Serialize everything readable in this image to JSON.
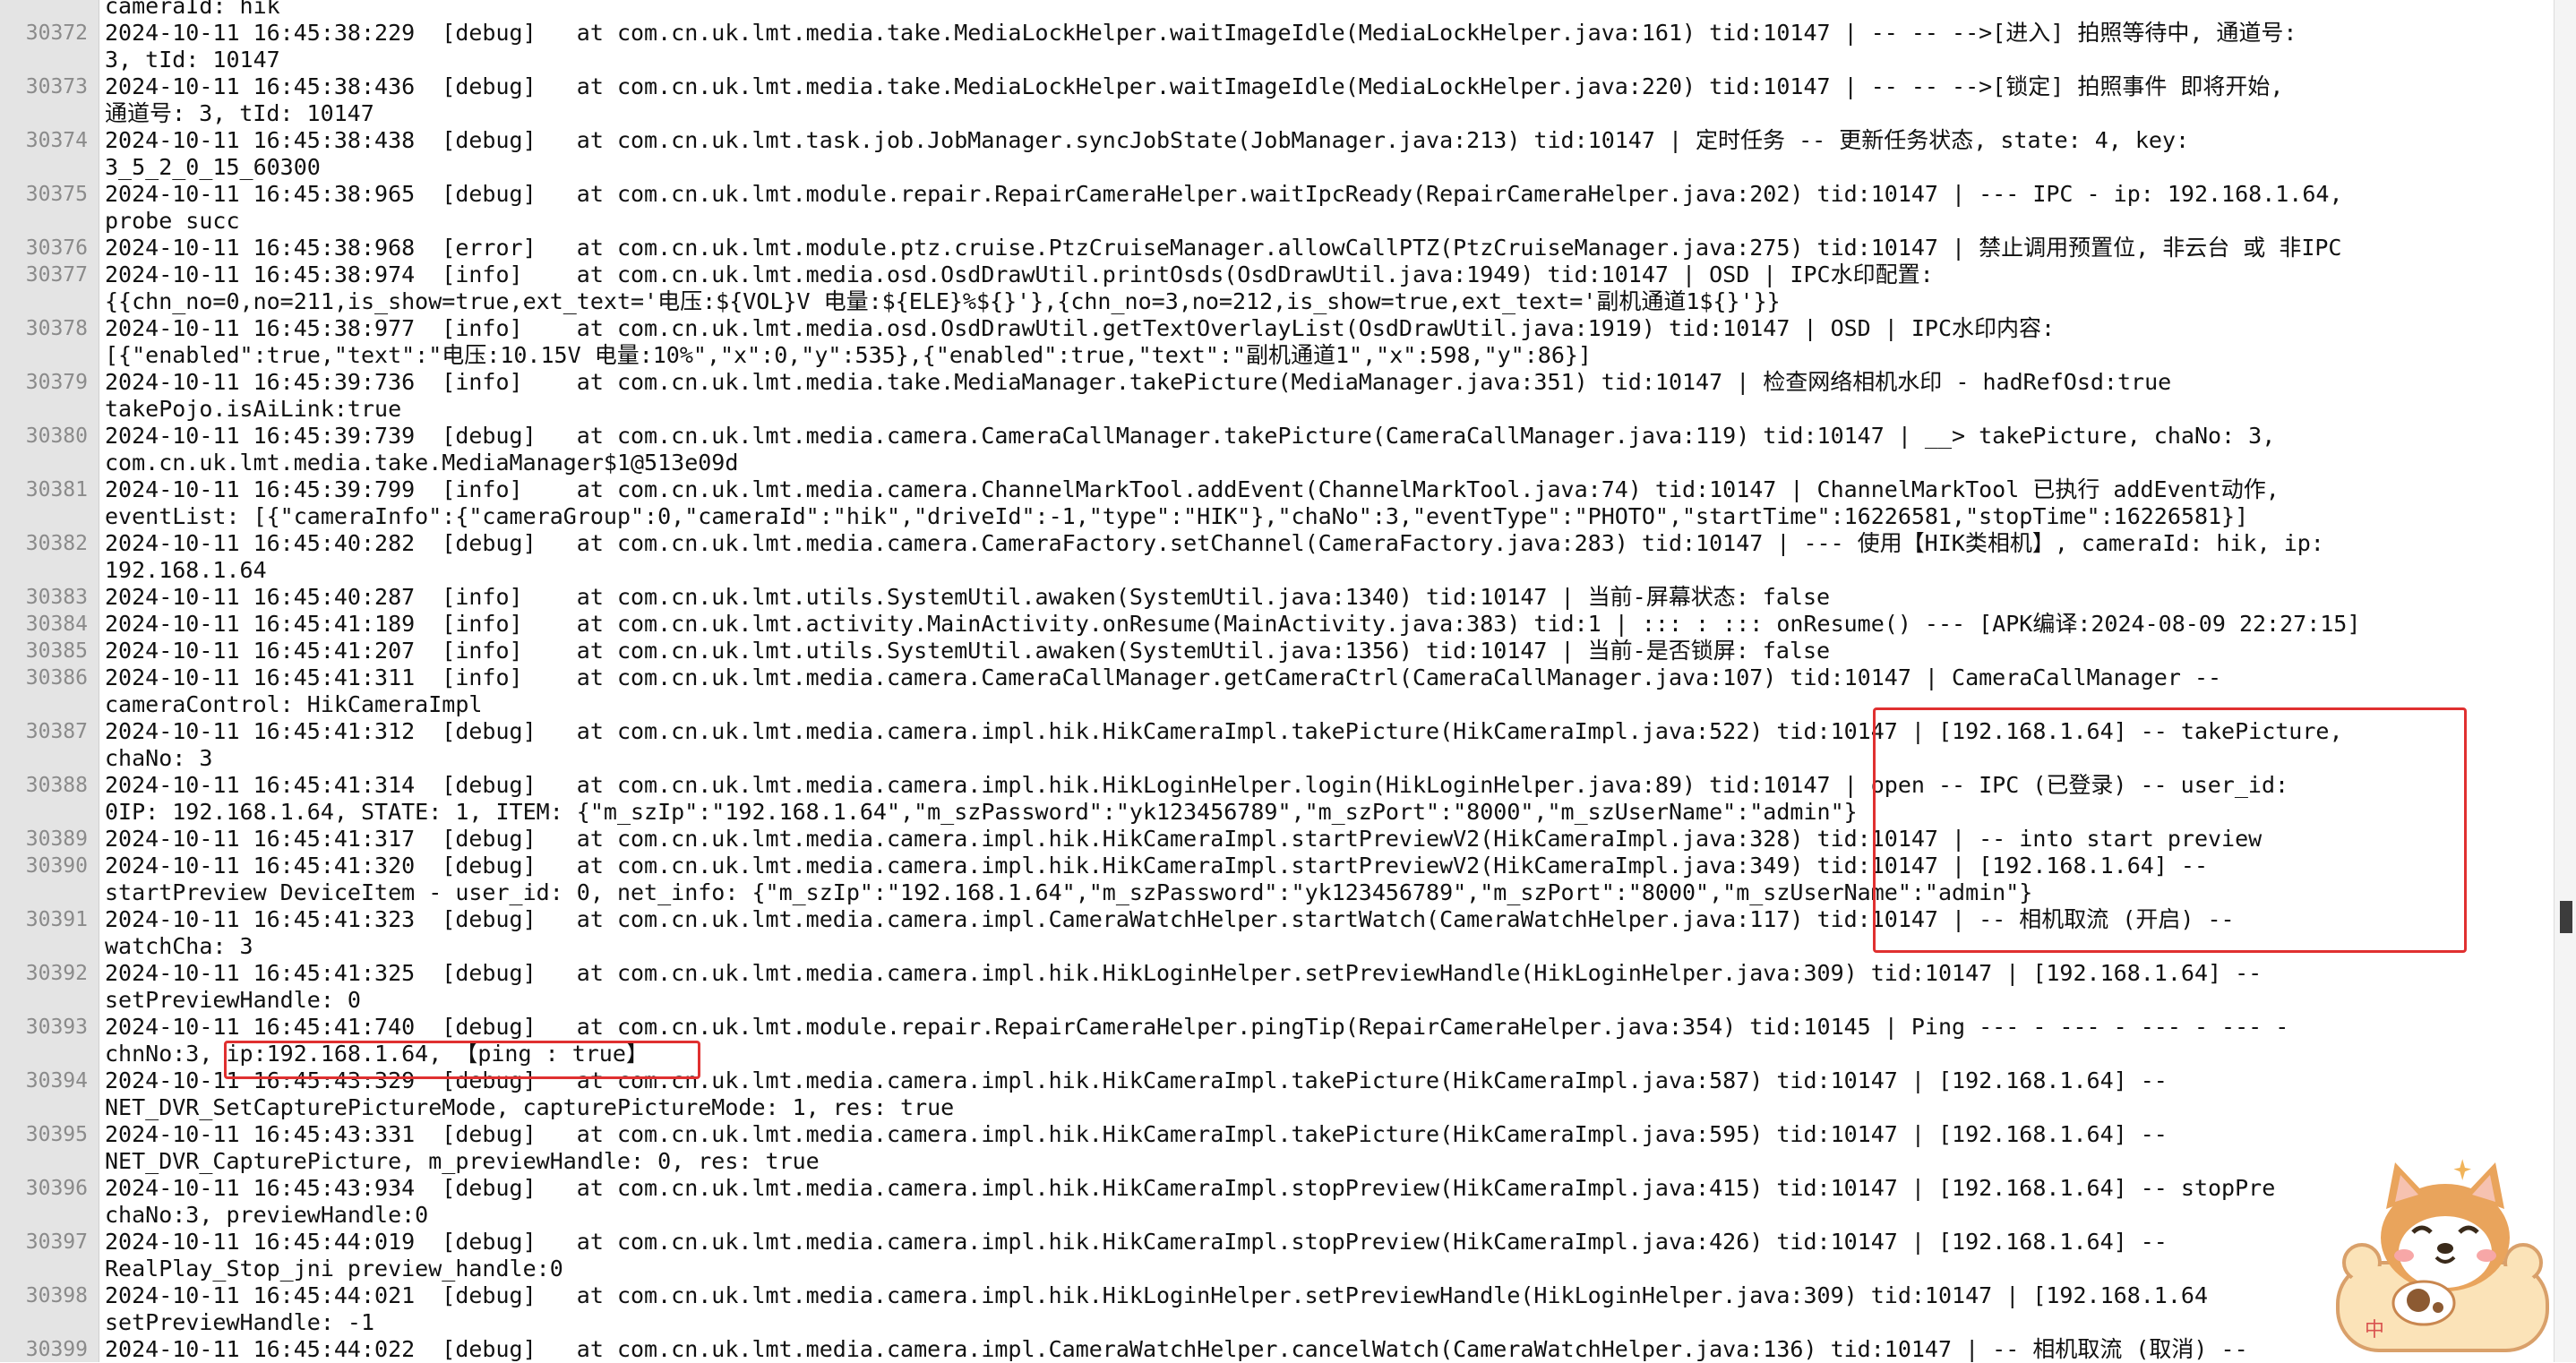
{
  "editor": {
    "lines": [
      {
        "num": "",
        "text": "cameraId: hik"
      },
      {
        "num": "30372",
        "text": "2024-10-11 16:45:38:229  [debug]   at com.cn.uk.lmt.media.take.MediaLockHelper.waitImageIdle(MediaLockHelper.java:161) tid:10147 | -- -- -->[进入] 拍照等待中, 通道号:"
      },
      {
        "num": "",
        "text": "3, tId: 10147"
      },
      {
        "num": "30373",
        "text": "2024-10-11 16:45:38:436  [debug]   at com.cn.uk.lmt.media.take.MediaLockHelper.waitImageIdle(MediaLockHelper.java:220) tid:10147 | -- -- -->[锁定] 拍照事件 即将开始,"
      },
      {
        "num": "",
        "text": "通道号: 3, tId: 10147"
      },
      {
        "num": "30374",
        "text": "2024-10-11 16:45:38:438  [debug]   at com.cn.uk.lmt.task.job.JobManager.syncJobState(JobManager.java:213) tid:10147 | 定时任务 -- 更新任务状态, state: 4, key:"
      },
      {
        "num": "",
        "text": "3_5_2_0_15_60300"
      },
      {
        "num": "30375",
        "text": "2024-10-11 16:45:38:965  [debug]   at com.cn.uk.lmt.module.repair.RepairCameraHelper.waitIpcReady(RepairCameraHelper.java:202) tid:10147 | --- IPC - ip: 192.168.1.64,"
      },
      {
        "num": "",
        "text": "probe succ"
      },
      {
        "num": "30376",
        "text": "2024-10-11 16:45:38:968  [error]   at com.cn.uk.lmt.module.ptz.cruise.PtzCruiseManager.allowCallPTZ(PtzCruiseManager.java:275) tid:10147 | 禁止调用预置位, 非云台 或 非IPC"
      },
      {
        "num": "30377",
        "text": "2024-10-11 16:45:38:974  [info]    at com.cn.uk.lmt.media.osd.OsdDrawUtil.printOsds(OsdDrawUtil.java:1949) tid:10147 | OSD | IPC水印配置:"
      },
      {
        "num": "",
        "text": "{{chn_no=0,no=211,is_show=true,ext_text='电压:${VOL}V 电量:${ELE}%${}'},{chn_no=3,no=212,is_show=true,ext_text='副机通道1${}'}}"
      },
      {
        "num": "30378",
        "text": "2024-10-11 16:45:38:977  [info]    at com.cn.uk.lmt.media.osd.OsdDrawUtil.getTextOverlayList(OsdDrawUtil.java:1919) tid:10147 | OSD | IPC水印内容:"
      },
      {
        "num": "",
        "text": "[{\"enabled\":true,\"text\":\"电压:10.15V 电量:10%\",\"x\":0,\"y\":535},{\"enabled\":true,\"text\":\"副机通道1\",\"x\":598,\"y\":86}]"
      },
      {
        "num": "30379",
        "text": "2024-10-11 16:45:39:736  [info]    at com.cn.uk.lmt.media.take.MediaManager.takePicture(MediaManager.java:351) tid:10147 | 检查网络相机水印 - hadRefOsd:true"
      },
      {
        "num": "",
        "text": "takePojo.isAiLink:true"
      },
      {
        "num": "30380",
        "text": "2024-10-11 16:45:39:739  [debug]   at com.cn.uk.lmt.media.camera.CameraCallManager.takePicture(CameraCallManager.java:119) tid:10147 | __> takePicture, chaNo: 3,"
      },
      {
        "num": "",
        "text": "com.cn.uk.lmt.media.take.MediaManager$1@513e09d"
      },
      {
        "num": "30381",
        "text": "2024-10-11 16:45:39:799  [info]    at com.cn.uk.lmt.media.camera.ChannelMarkTool.addEvent(ChannelMarkTool.java:74) tid:10147 | ChannelMarkTool 已执行 addEvent动作,"
      },
      {
        "num": "",
        "text": "eventList: [{\"cameraInfo\":{\"cameraGroup\":0,\"cameraId\":\"hik\",\"driveId\":-1,\"type\":\"HIK\"},\"chaNo\":3,\"eventType\":\"PHOTO\",\"startTime\":16226581,\"stopTime\":16226581}]"
      },
      {
        "num": "30382",
        "text": "2024-10-11 16:45:40:282  [debug]   at com.cn.uk.lmt.media.camera.CameraFactory.setChannel(CameraFactory.java:283) tid:10147 | --- 使用【HIK类相机】, cameraId: hik, ip:"
      },
      {
        "num": "",
        "text": "192.168.1.64"
      },
      {
        "num": "30383",
        "text": "2024-10-11 16:45:40:287  [info]    at com.cn.uk.lmt.utils.SystemUtil.awaken(SystemUtil.java:1340) tid:10147 | 当前-屏幕状态: false"
      },
      {
        "num": "30384",
        "text": "2024-10-11 16:45:41:189  [info]    at com.cn.uk.lmt.activity.MainActivity.onResume(MainActivity.java:383) tid:1 | ::: : ::: onResume() --- [APK编译:2024-08-09 22:27:15]"
      },
      {
        "num": "30385",
        "text": "2024-10-11 16:45:41:207  [info]    at com.cn.uk.lmt.utils.SystemUtil.awaken(SystemUtil.java:1356) tid:10147 | 当前-是否锁屏: false"
      },
      {
        "num": "30386",
        "text": "2024-10-11 16:45:41:311  [info]    at com.cn.uk.lmt.media.camera.CameraCallManager.getCameraCtrl(CameraCallManager.java:107) tid:10147 | CameraCallManager --"
      },
      {
        "num": "",
        "text": "cameraControl: HikCameraImpl"
      },
      {
        "num": "30387",
        "text": "2024-10-11 16:45:41:312  [debug]   at com.cn.uk.lmt.media.camera.impl.hik.HikCameraImpl.takePicture(HikCameraImpl.java:522) tid:10147 | [192.168.1.64] -- takePicture,"
      },
      {
        "num": "",
        "text": "chaNo: 3"
      },
      {
        "num": "30388",
        "text": "2024-10-11 16:45:41:314  [debug]   at com.cn.uk.lmt.media.camera.impl.hik.HikLoginHelper.login(HikLoginHelper.java:89) tid:10147 | open -- IPC (已登录) -- user_id:"
      },
      {
        "num": "",
        "text": "0IP: 192.168.1.64, STATE: 1, ITEM: {\"m_szIp\":\"192.168.1.64\",\"m_szPassword\":\"yk123456789\",\"m_szPort\":\"8000\",\"m_szUserName\":\"admin\"}"
      },
      {
        "num": "30389",
        "text": "2024-10-11 16:45:41:317  [debug]   at com.cn.uk.lmt.media.camera.impl.hik.HikCameraImpl.startPreviewV2(HikCameraImpl.java:328) tid:10147 | -- into start preview"
      },
      {
        "num": "30390",
        "text": "2024-10-11 16:45:41:320  [debug]   at com.cn.uk.lmt.media.camera.impl.hik.HikCameraImpl.startPreviewV2(HikCameraImpl.java:349) tid:10147 | [192.168.1.64] --"
      },
      {
        "num": "",
        "text": "startPreview DeviceItem - user_id: 0, net_info: {\"m_szIp\":\"192.168.1.64\",\"m_szPassword\":\"yk123456789\",\"m_szPort\":\"8000\",\"m_szUserName\":\"admin\"}"
      },
      {
        "num": "30391",
        "text": "2024-10-11 16:45:41:323  [debug]   at com.cn.uk.lmt.media.camera.impl.CameraWatchHelper.startWatch(CameraWatchHelper.java:117) tid:10147 | -- 相机取流 (开启) --"
      },
      {
        "num": "",
        "text": "watchCha: 3"
      },
      {
        "num": "30392",
        "text": "2024-10-11 16:45:41:325  [debug]   at com.cn.uk.lmt.media.camera.impl.hik.HikLoginHelper.setPreviewHandle(HikLoginHelper.java:309) tid:10147 | [192.168.1.64] --"
      },
      {
        "num": "",
        "text": "setPreviewHandle: 0"
      },
      {
        "num": "30393",
        "text": "2024-10-11 16:45:41:740  [debug]   at com.cn.uk.lmt.module.repair.RepairCameraHelper.pingTip(RepairCameraHelper.java:354) tid:10145 | Ping --- - --- - --- - --- -"
      },
      {
        "num": "",
        "text": "chnNo:3, ip:192.168.1.64, 【ping : true】"
      },
      {
        "num": "30394",
        "text": "2024-10-11 16:45:43:329  [debug]   at com.cn.uk.lmt.media.camera.impl.hik.HikCameraImpl.takePicture(HikCameraImpl.java:587) tid:10147 | [192.168.1.64] --"
      },
      {
        "num": "",
        "text": "NET_DVR_SetCapturePictureMode, capturePictureMode: 1, res: true"
      },
      {
        "num": "30395",
        "text": "2024-10-11 16:45:43:331  [debug]   at com.cn.uk.lmt.media.camera.impl.hik.HikCameraImpl.takePicture(HikCameraImpl.java:595) tid:10147 | [192.168.1.64] --"
      },
      {
        "num": "",
        "text": "NET_DVR_CapturePicture, m_previewHandle: 0, res: true"
      },
      {
        "num": "30396",
        "text": "2024-10-11 16:45:43:934  [debug]   at com.cn.uk.lmt.media.camera.impl.hik.HikCameraImpl.stopPreview(HikCameraImpl.java:415) tid:10147 | [192.168.1.64] -- stopPre"
      },
      {
        "num": "",
        "text": "chaNo:3, previewHandle:0"
      },
      {
        "num": "30397",
        "text": "2024-10-11 16:45:44:019  [debug]   at com.cn.uk.lmt.media.camera.impl.hik.HikCameraImpl.stopPreview(HikCameraImpl.java:426) tid:10147 | [192.168.1.64] --"
      },
      {
        "num": "",
        "text": "RealPlay_Stop_jni preview_handle:0"
      },
      {
        "num": "30398",
        "text": "2024-10-11 16:45:44:021  [debug]   at com.cn.uk.lmt.media.camera.impl.hik.HikLoginHelper.setPreviewHandle(HikLoginHelper.java:309) tid:10147 | [192.168.1.64"
      },
      {
        "num": "",
        "text": "setPreviewHandle: -1"
      },
      {
        "num": "30399",
        "text": "2024-10-11 16:45:44:022  [debug]   at com.cn.uk.lmt.media.camera.impl.CameraWatchHelper.cancelWatch(CameraWatchHelper.java:136) tid:10147 | -- 相机取流 (取消) --"
      }
    ]
  },
  "highlight_color": "#e03030",
  "mascot": {
    "icon": "shiba-dog-sticker-icon",
    "text": "中"
  }
}
